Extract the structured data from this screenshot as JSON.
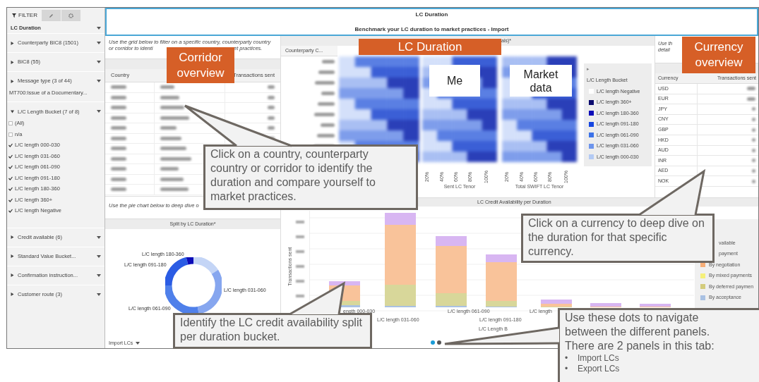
{
  "sidebar": {
    "tabs": [
      {
        "kind": "filter",
        "label": "FILTER",
        "selected": true
      },
      {
        "kind": "edit",
        "selected": false
      },
      {
        "kind": "settings",
        "selected": false
      }
    ],
    "sheet": "LC Duration",
    "filters": [
      {
        "label": "Counterparty BIC8 (1501)",
        "expanded": false
      },
      {
        "label": "BIC8 (55)",
        "expanded": false
      },
      {
        "label": "Message type (3 of 44)",
        "expanded": false,
        "summary": "MT700:Issue of a Documentary..."
      },
      {
        "label": "L/C Length Bucket (7 of 8)",
        "expanded": true,
        "options": [
          {
            "label": "(All)",
            "checked": false
          },
          {
            "label": "n/a",
            "checked": false
          },
          {
            "label": "L/C length 000-030",
            "checked": true
          },
          {
            "label": "L/C length 031-060",
            "checked": true
          },
          {
            "label": "L/C length 061-090",
            "checked": true
          },
          {
            "label": "L/C length 091-180",
            "checked": true
          },
          {
            "label": "L/C length 180-360",
            "checked": true
          },
          {
            "label": "L/C length 360+",
            "checked": true
          },
          {
            "label": "L/C length Negative",
            "checked": true
          }
        ]
      },
      {
        "label": "Credit available (6)",
        "expanded": false
      },
      {
        "label": "Standard Value Bucket...",
        "expanded": false
      },
      {
        "label": "Confirmation instruction...",
        "expanded": false
      },
      {
        "label": "Customer route (3)",
        "expanded": false
      }
    ]
  },
  "header": {
    "title": "LC Duration",
    "subtitle": "Benchmark your LC duration to market practices - Import"
  },
  "corridor": {
    "hint_lines": [
      "Use the grid below to filter on a specific country, counterparty country",
      "or corridor to identi",
      "et practices."
    ],
    "columns": [
      "Country",
      "Transactions sent"
    ]
  },
  "pie_hint": "Use the pie chart below to deep dive o",
  "donut": {
    "title": "Split by LC Duration*",
    "labels": [
      "L/C length 180-360",
      "L/C length 091-180",
      "L/C length 031-060",
      "L/C length 061-090"
    ]
  },
  "heatmap": {
    "header": "als)*",
    "row_header": "Counterparty C...",
    "axes": [
      {
        "ticks": [
          "20%",
          "40%",
          "60%",
          "80%",
          "100%"
        ],
        "title": "Sent LC Tenor"
      },
      {
        "ticks": [
          "20%",
          "40%",
          "60%",
          "80%",
          "100%"
        ],
        "title": "Total SWIFT LC Tenor"
      }
    ],
    "legend": {
      "toggle": "▸",
      "title": "L/C Length Bucket",
      "items": [
        {
          "label": "L/C length Negative",
          "color": "#ffffff"
        },
        {
          "label": "L/C length 360+",
          "color": "#0a0a6e"
        },
        {
          "label": "L/C length 180-360",
          "color": "#0b0bb8"
        },
        {
          "label": "L/C length 091-180",
          "color": "#1545e0"
        },
        {
          "label": "L/C length 061-090",
          "color": "#3c72e8"
        },
        {
          "label": "L/C length 031-060",
          "color": "#6d94ec"
        },
        {
          "label": "L/C length 000-030",
          "color": "#b3caf4"
        }
      ]
    }
  },
  "currency": {
    "hint_lines": [
      "Use th",
      "detail"
    ],
    "columns": [
      "Currency",
      "Transactions sent"
    ],
    "rows": [
      "USD",
      "EUR",
      "JPY",
      "CNY",
      "GBP",
      "HKD",
      "AUD",
      "INR",
      "AED",
      "NOK"
    ]
  },
  "bar_chart": {
    "title": "LC Credit Availability per Duration",
    "ylabel": "Transactions sent",
    "xlabels": [
      "ength 000-030",
      "L/C length 031-060",
      "L/C length 061-090",
      "L/C length 091-180",
      "L/C length"
    ],
    "xlabel": "L/C Length B",
    "legend": [
      {
        "label": "vailable"
      },
      {
        "label": "payment"
      },
      {
        "label": "By negotiation",
        "color": "#f7ae78"
      },
      {
        "label": "By mixed payments",
        "color": "#f5f07a"
      },
      {
        "label": "By deferred paymen",
        "color": "#d3cc7c"
      },
      {
        "label": "By acceptance",
        "color": "#a9c1e3"
      }
    ]
  },
  "footer": {
    "view": "Import LCs",
    "pages": [
      {
        "selected": true
      },
      {
        "selected": false
      }
    ]
  },
  "annotations": [
    {
      "kind": "banner",
      "lines": [
        "Corridor",
        "overview"
      ]
    },
    {
      "kind": "banner",
      "lines": [
        "LC Duration"
      ]
    },
    {
      "kind": "banner",
      "lines": [
        "Currency",
        "overview"
      ]
    },
    {
      "kind": "label",
      "lines": [
        "Me"
      ]
    },
    {
      "kind": "label",
      "lines": [
        "Market",
        "data"
      ]
    },
    {
      "kind": "callout",
      "text": "Click on a country,  counterparty country  or corridor to identify the duration and compare yourself to market practices."
    },
    {
      "kind": "callout",
      "text": "Click on a currency to deep dive on the duration for that specific currency."
    },
    {
      "kind": "callout",
      "text": "Identify  the LC credit availability split per duration bucket."
    },
    {
      "kind": "callout",
      "text": "Use these dots to navigate between the different panels. There are 2 panels in this tab:",
      "bullets": [
        {
          "mark": "•",
          "text": "Import LCs"
        },
        {
          "mark": "•",
          "text": "Export LCs"
        }
      ]
    }
  ]
}
